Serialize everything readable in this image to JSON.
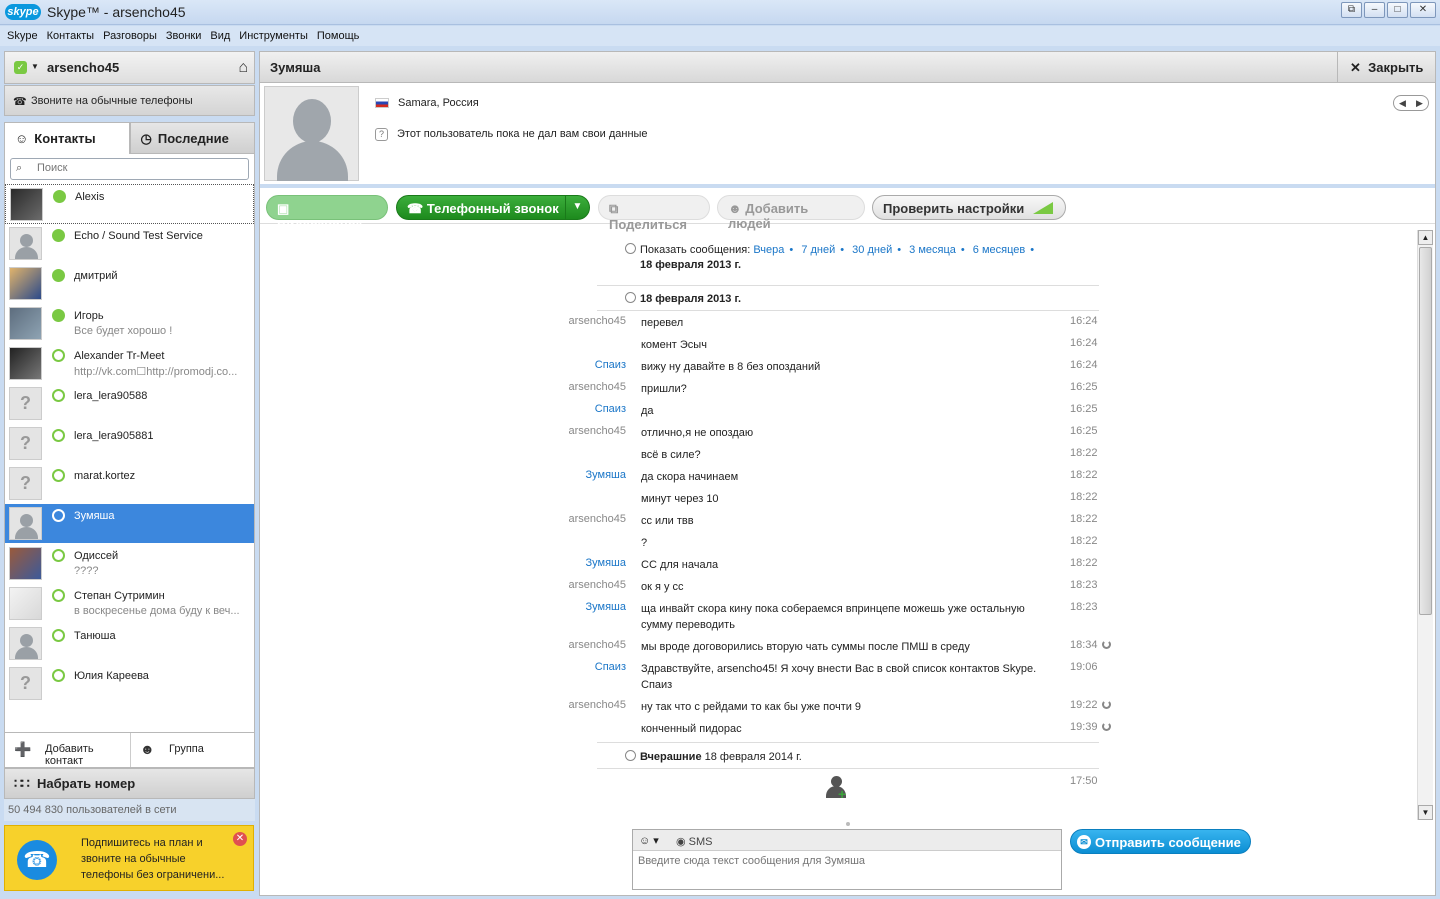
{
  "window": {
    "logo": "skype",
    "title": "Skype™ - arsencho45",
    "buttons": [
      "restore",
      "minimize",
      "maximize",
      "close"
    ]
  },
  "menu": [
    "Skype",
    "Контакты",
    "Разговоры",
    "Звонки",
    "Вид",
    "Инструменты",
    "Помощь"
  ],
  "user": {
    "name": "arsencho45",
    "status_color": "#7ac943",
    "status_icon": "online-check-icon",
    "home_icon": "home-icon"
  },
  "call_phones": "Звоните на обычные телефоны",
  "tabs": {
    "contacts": "Контакты",
    "recent": "Последние"
  },
  "search": {
    "placeholder": "Поиск"
  },
  "contacts": [
    {
      "name": "Alexis",
      "mood": "",
      "status": "online"
    },
    {
      "name": "Echo / Sound Test Service",
      "mood": "",
      "status": "online"
    },
    {
      "name": "дмитрий",
      "mood": "",
      "status": "online"
    },
    {
      "name": "Игорь",
      "mood": "Все будет хорошо !",
      "status": "online"
    },
    {
      "name": "Alexander Tr-Meet",
      "mood": "http://vk.com☐http://promodj.co...",
      "status": "offline"
    },
    {
      "name": "lera_lera90588",
      "mood": "",
      "status": "offline"
    },
    {
      "name": "lera_lera905881",
      "mood": "",
      "status": "offline"
    },
    {
      "name": "marat.kortez",
      "mood": "",
      "status": "offline"
    },
    {
      "name": "Зумяша",
      "mood": "",
      "status": "selected"
    },
    {
      "name": "Одиссей",
      "mood": "????",
      "status": "offline"
    },
    {
      "name": "Степан Сутримин",
      "mood": "в воскресенье дома буду к веч...",
      "status": "offline"
    },
    {
      "name": "Танюша",
      "mood": "",
      "status": "offline"
    },
    {
      "name": "Юлия Кареева",
      "mood": "",
      "status": "offline"
    }
  ],
  "left_buttons": {
    "add_contact": "Добавить контакт",
    "group": "Группа"
  },
  "dial": "Набрать номер",
  "online_count": "50 494 830 пользователей в сети",
  "promo": {
    "text": "Подпишитесь на план и звоните на обычные телефоны без ограничени..."
  },
  "conversation": {
    "title": "Зумяша",
    "close_label": "Закрыть",
    "location": "Samara, Россия",
    "info": "Этот пользователь пока не дал вам свои данные"
  },
  "toolbar": {
    "video": "Видеозвонок",
    "call": "Телефонный звонок",
    "share": "Поделиться",
    "add_people": "Добавить людей",
    "check_settings": "Проверить настройки"
  },
  "history": {
    "show_label": "Показать сообщения:",
    "filters": [
      "Вчера",
      "7 дней",
      "30 дней",
      "3 месяца",
      "6 месяцев"
    ],
    "show_date": "18 февраля 2013 г.",
    "day1": "18 февраля 2013 г.",
    "day2_bold": "Вчерашние",
    "day2_date": "18 февраля 2014 г.",
    "last_time": "17:50",
    "messages": [
      {
        "author": "arsencho45",
        "text": "перевел",
        "time": "16:24",
        "pending": false
      },
      {
        "author": "",
        "text": "комент Эсыч",
        "time": "16:24",
        "pending": false
      },
      {
        "author": "Спаиз",
        "text": "вижу ну давайте в 8 без опозданий",
        "time": "16:24",
        "pending": false
      },
      {
        "author": "arsencho45",
        "text": "пришли?",
        "time": "16:25",
        "pending": false
      },
      {
        "author": "Спаиз",
        "text": "да",
        "time": "16:25",
        "pending": false
      },
      {
        "author": "arsencho45",
        "text": "отлично,я не опоздаю",
        "time": "16:25",
        "pending": false
      },
      {
        "author": "",
        "text": "всё в силе?",
        "time": "18:22",
        "pending": false
      },
      {
        "author": "Зумяша",
        "text": "да скора начинаем",
        "time": "18:22",
        "pending": false
      },
      {
        "author": "",
        "text": "минут через 10",
        "time": "18:22",
        "pending": false
      },
      {
        "author": "arsencho45",
        "text": "сс или твв",
        "time": "18:22",
        "pending": false
      },
      {
        "author": "",
        "text": "?",
        "time": "18:22",
        "pending": false
      },
      {
        "author": "Зумяша",
        "text": "СС для начала",
        "time": "18:22",
        "pending": false
      },
      {
        "author": "arsencho45",
        "text": "ок я у сс",
        "time": "18:23",
        "pending": false
      },
      {
        "author": "Зумяша",
        "text": "ща инвайт скора кину пока собераемся впринцепе можешь уже остальную сумму переводить",
        "time": "18:23",
        "pending": false
      },
      {
        "author": "arsencho45",
        "text": "мы вроде договорились вторую чать суммы после ПМШ в среду",
        "time": "18:34",
        "pending": true
      },
      {
        "author": "Спаиз",
        "text": "Здравствуйте, arsencho45! Я хочу внести Вас в свой список контактов Skype. Спаиз",
        "time": "19:06",
        "pending": false
      },
      {
        "author": "arsencho45",
        "text": "ну так что с рейдами то как бы уже почти 9",
        "time": "19:22",
        "pending": true
      },
      {
        "author": "",
        "text": "конченный пидорас",
        "time": "19:39",
        "pending": true
      }
    ]
  },
  "compose": {
    "sms_label": "SMS",
    "placeholder": "Введите сюда текст сообщения для Зумяша"
  },
  "send_label": "Отправить сообщение",
  "colors": {
    "accent_blue": "#3c87dd",
    "call_green": "#1d8a1d",
    "online_green": "#7ac943",
    "link_blue": "#1a76c8"
  }
}
